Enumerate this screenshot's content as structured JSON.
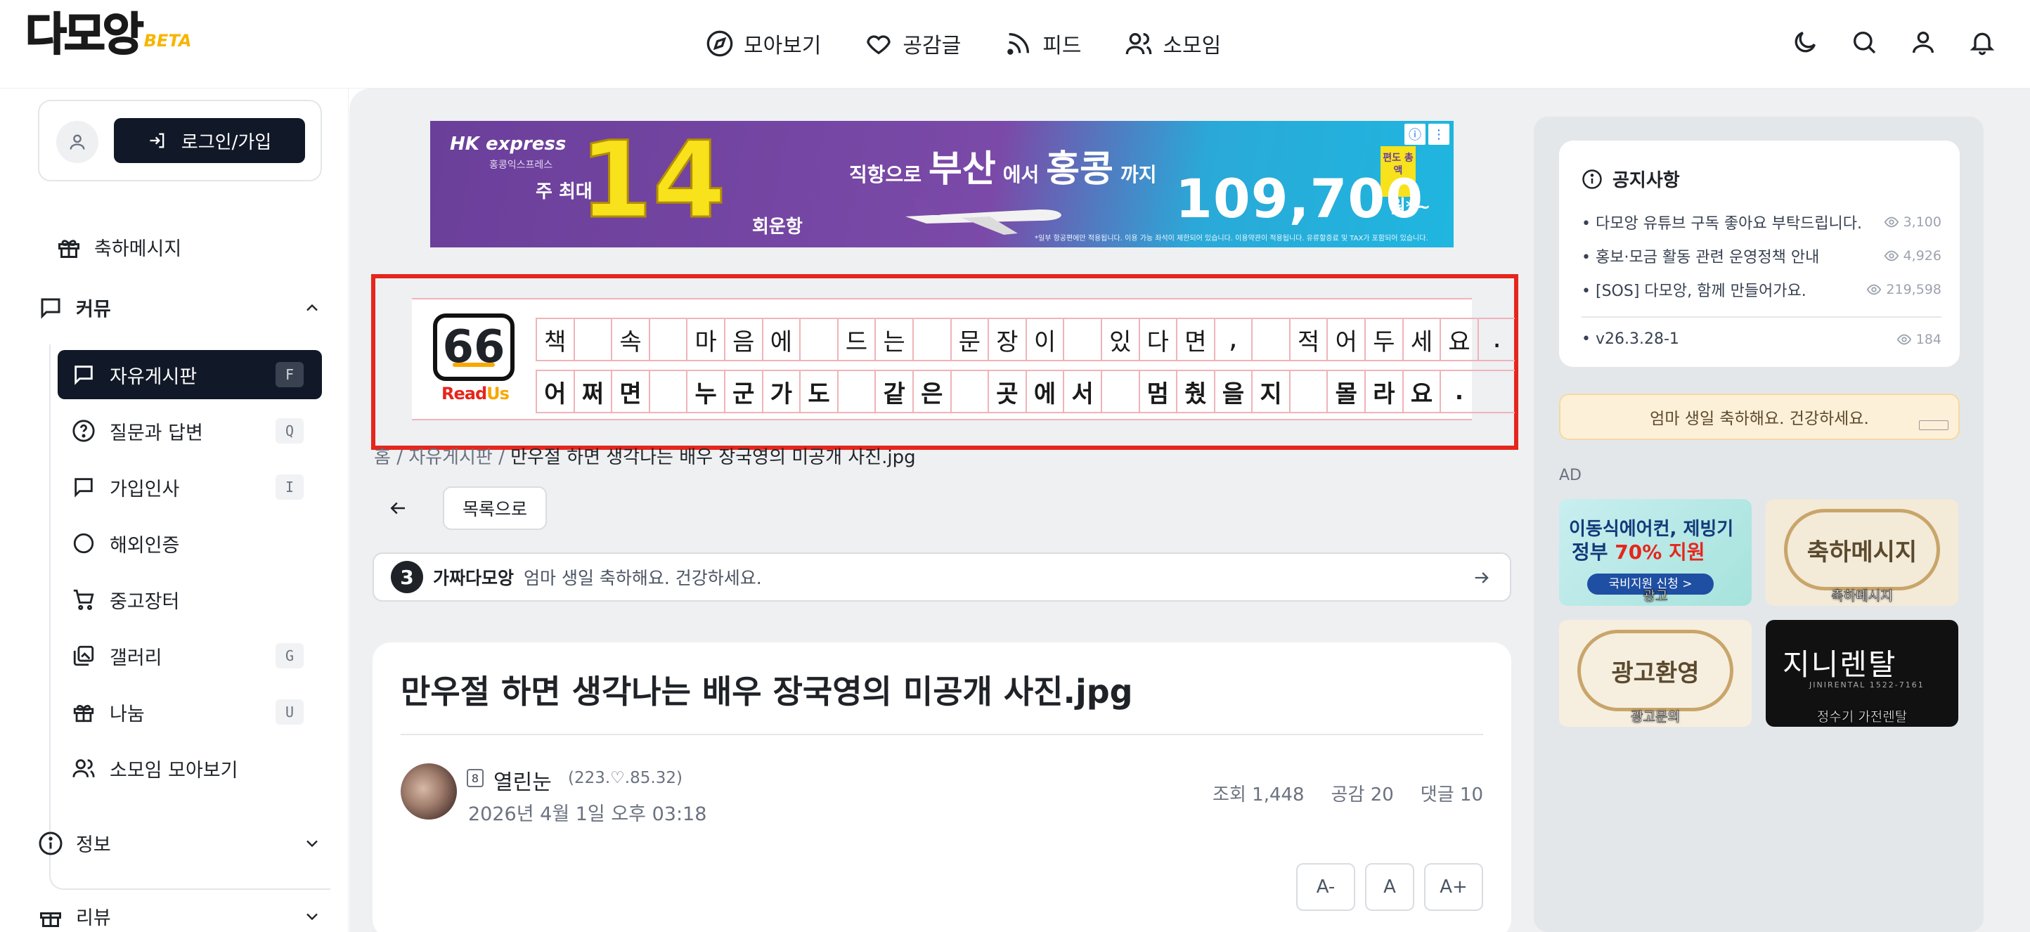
{
  "header": {
    "logo": "다모앙",
    "logo_badge": "BETA",
    "nav": [
      {
        "label": "모아보기",
        "icon": "compass-icon"
      },
      {
        "label": "공감글",
        "icon": "heart-icon"
      },
      {
        "label": "피드",
        "icon": "rss-icon"
      },
      {
        "label": "소모임",
        "icon": "users-icon"
      }
    ],
    "actions": [
      "moon-icon",
      "search-icon",
      "user-icon",
      "bell-icon"
    ]
  },
  "sidebar": {
    "login_label": "로그인/가입",
    "celebrate": "축하메시지",
    "community_section": "커뮤",
    "community_items": [
      {
        "label": "자유게시판",
        "key": "F",
        "active": true
      },
      {
        "label": "질문과 답변",
        "key": "Q"
      },
      {
        "label": "가입인사",
        "key": "I"
      },
      {
        "label": "해외인증",
        "key": ""
      },
      {
        "label": "중고장터",
        "key": ""
      },
      {
        "label": "갤러리",
        "key": "G"
      },
      {
        "label": "나눔",
        "key": "U"
      },
      {
        "label": "소모임 모아보기",
        "key": ""
      }
    ],
    "info_section": "정보",
    "review_section": "리뷰"
  },
  "ad_banner": {
    "brand": "HK express",
    "brand_sub": "홍콩익스프레스",
    "weekly_prefix": "주 최대",
    "count": "14",
    "count_suffix": "회운항",
    "route_pre": "직항으로",
    "origin": "부산",
    "route_mid": "에서",
    "destination": "홍콩",
    "route_post": "까지",
    "price": "109,700",
    "price_unit": "원*~",
    "tag": "편도 총액",
    "fine_print": "*일부 항공편에만 적용됩니다. 이용 가능 좌석이 제한되어 있습니다. 이용약관이 적용됩니다. 유류할증료 및 TAX가 포함되어 있습니다."
  },
  "readus": {
    "brand_a": "Read",
    "brand_b": "Us",
    "logo_glyph": "66",
    "line1": [
      "책",
      " ",
      "속",
      " ",
      "마",
      "음",
      "에",
      " ",
      "드",
      "는",
      " ",
      "문",
      "장",
      "이",
      " ",
      "있",
      "다",
      "면",
      ",",
      " ",
      "적",
      "어",
      "두",
      "세",
      "요",
      "."
    ],
    "line2": [
      "어",
      "쩌",
      "면",
      " ",
      "누",
      "군",
      "가",
      "도",
      " ",
      "같",
      "은",
      " ",
      "곳",
      "에",
      "서",
      " ",
      "멈",
      "췄",
      "을",
      "지",
      " ",
      "몰",
      "라",
      "요",
      "."
    ]
  },
  "breadcrumb": {
    "home": "홈",
    "board": "자유게시판",
    "current": "만우절 하면 생각나는 배우 장국영의 미공개 사진.jpg",
    "sep": "/"
  },
  "list_button": "목록으로",
  "notice_strip": {
    "badge": "3",
    "name": "가짜다모앙",
    "message": "엄마 생일 축하해요. 건강하세요."
  },
  "post": {
    "title": "만우절 하면 생각나는 배우 장국영의 미공개 사진.jpg",
    "level": "8",
    "author": "열린눈",
    "ip": "(223.♡.85.32)",
    "date": "2026년 4월 1일 오후 03:18",
    "views": "조회 1,448",
    "likes": "공감 20",
    "comments": "댓글 10",
    "font_buttons": [
      "A-",
      "A",
      "A+"
    ]
  },
  "right": {
    "notice_title": "공지사항",
    "notices": [
      {
        "text": "다모앙 유튜브 구독 좋아요 부탁드립니다.",
        "views": "3,100"
      },
      {
        "text": "홍보·모금 활동 관련 운영정책 안내",
        "views": "4,926"
      },
      {
        "text": "[SOS] 다모앙, 함께 만들어가요.",
        "views": "219,598"
      }
    ],
    "version": {
      "text": "v26.3.28-1",
      "views": "184"
    },
    "bday": "엄마 생일 축하해요. 건강하세요.",
    "ad_label": "AD",
    "ads": [
      {
        "line1": "이동식에어컨, 제빙기",
        "line2a": "정부 ",
        "line2b": "70% 지원",
        "pill": "국비지원 신청 >",
        "caption": "광고"
      },
      {
        "text": "축하메시지",
        "caption": "축하메시지"
      },
      {
        "text": "광고환영",
        "caption": "광고문의"
      },
      {
        "text": "지니렌탈",
        "sub": "JINIRENTAL 1522-7161",
        "caption": "정수기 가전렌탈"
      }
    ]
  }
}
